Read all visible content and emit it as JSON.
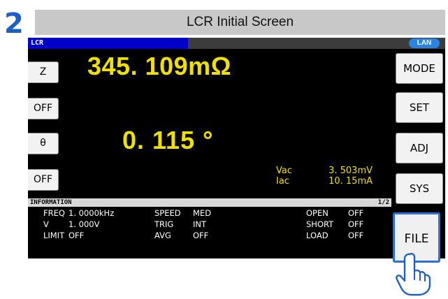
{
  "step_number": "2",
  "title": "LCR Initial Screen",
  "status": {
    "mode_label": "LCR",
    "lan_badge": "LAN"
  },
  "left_buttons": [
    "Z",
    "OFF",
    "θ",
    "OFF"
  ],
  "right_buttons": [
    "MODE",
    "SET",
    "ADJ",
    "SYS",
    "FILE"
  ],
  "main_reading": "345. 109mΩ",
  "second_reading": "0. 115  °",
  "monitor": {
    "vac_label": "Vac",
    "vac_value": "3. 503mV",
    "iac_label": "Iac",
    "iac_value": "10. 15mA"
  },
  "information": {
    "header": "INFORMATION",
    "page": "1/2",
    "rows": [
      [
        "FREQ",
        "1. 0000kHz",
        "SPEED",
        "MED",
        "OPEN",
        "OFF"
      ],
      [
        "V",
        "1. 000V",
        "TRIG",
        "INT",
        "SHORT",
        "OFF"
      ],
      [
        "LIMIT",
        "OFF",
        "AVG",
        "OFF",
        "LOAD",
        "OFF"
      ]
    ]
  },
  "colors": {
    "step_number": "#1d5fc7",
    "reading": "#f0e000",
    "highlight_border": "#2d6fd8",
    "lan_badge": "#2a82e2",
    "status_blue": "#0000c8"
  },
  "icons": {
    "pointer": "pointing-hand-icon"
  }
}
